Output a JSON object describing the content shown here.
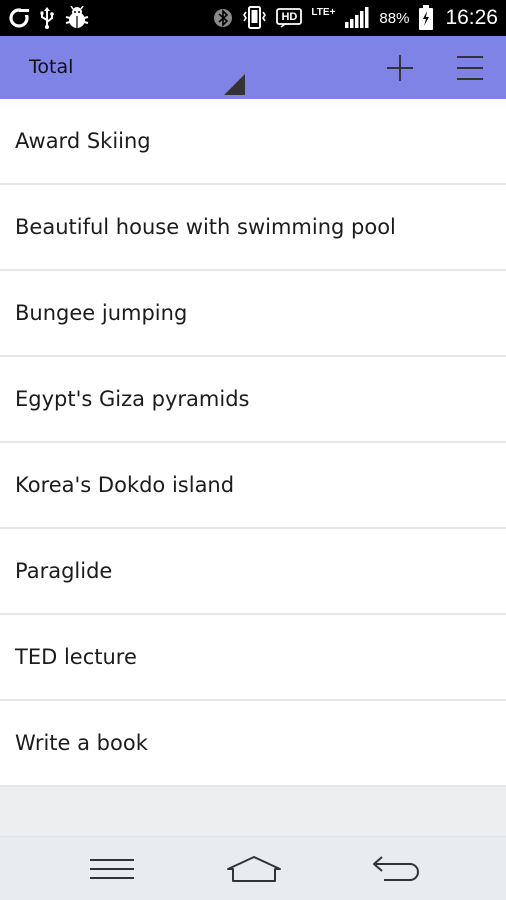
{
  "status_bar": {
    "icons_left": [
      "o-logo-icon",
      "usb-icon",
      "android-debug-icon"
    ],
    "icons_right": [
      "bluetooth-icon",
      "vibrate-icon",
      "hd-voice-icon",
      "lte-icon",
      "signal-icon",
      "battery-icon"
    ],
    "hd_label": "HD",
    "lte_label": "LTE+",
    "battery_percent": "88%",
    "time": "16:26"
  },
  "header": {
    "title": "Total",
    "background": "#7f83e6",
    "add_icon": "plus-icon",
    "menu_icon": "hamburger-menu-icon"
  },
  "items": [
    {
      "label": "Award Skiing"
    },
    {
      "label": "Beautiful house with swimming pool"
    },
    {
      "label": "Bungee jumping"
    },
    {
      "label": "Egypt's Giza pyramids"
    },
    {
      "label": "Korea's Dokdo island"
    },
    {
      "label": "Paraglide"
    },
    {
      "label": "TED lecture"
    },
    {
      "label": "Write a book"
    }
  ],
  "nav_bar": {
    "icons": [
      "menu-icon",
      "home-icon",
      "back-icon"
    ]
  }
}
